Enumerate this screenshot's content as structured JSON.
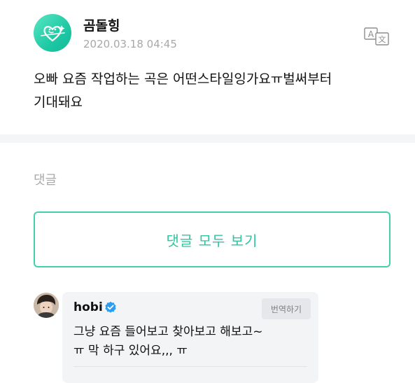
{
  "post": {
    "author": "곰돌힝",
    "date": "2020.03.18 04:45",
    "body": "오빠 요즘 작업하는 곡은 어떤스타일잉가요ㅠ벌써부터\n기대돼요"
  },
  "comments": {
    "section_label": "댓글",
    "view_all_label": "댓글 모두 보기"
  },
  "reply": {
    "author": "hobi",
    "translate_label": "번역하기",
    "body": "그냥 요즘 들어보고 찾아보고 해보고~\nㅠ 막 하구 있어요,,, ㅠ"
  },
  "colors": {
    "accent": "#2fc69d",
    "accent_border": "#43d1ab",
    "verified": "#2a9df4",
    "muted_text": "#a8a8a8"
  },
  "icons": {
    "translate": "translate-icon",
    "verified": "verified-badge-icon"
  }
}
